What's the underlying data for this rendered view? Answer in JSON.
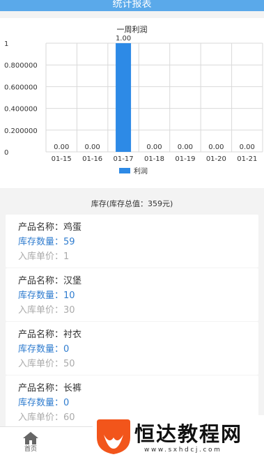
{
  "header": {
    "title": "统计报表"
  },
  "chart_data": {
    "type": "bar",
    "title": "一周利润",
    "categories": [
      "01-15",
      "01-16",
      "01-17",
      "01-18",
      "01-19",
      "01-20",
      "01-21"
    ],
    "series": [
      {
        "name": "利润",
        "values": [
          0,
          0,
          1,
          0,
          0,
          0,
          0
        ]
      }
    ],
    "data_labels": [
      "0.00",
      "0.00",
      "1.00",
      "0.00",
      "0.00",
      "0.00",
      "0.00"
    ],
    "y_ticks": [
      "0",
      "0.200000",
      "0.400000",
      "0.600000",
      "0.800000",
      "1"
    ],
    "ylim": [
      0,
      1
    ],
    "grid": true,
    "legend": "bottom-center",
    "bar_color": "#2d8ae6"
  },
  "inventory": {
    "title": "库存(库存总值：359元)",
    "items": [
      {
        "name": "产品名称：鸡蛋",
        "qty": "库存数量：59",
        "price": "入库单价：1"
      },
      {
        "name": "产品名称：汉堡",
        "qty": "库存数量：10",
        "price": "入库单价：30"
      },
      {
        "name": "产品名称：衬衣",
        "qty": "库存数量：0",
        "price": "入库单价：50"
      },
      {
        "name": "产品名称：长裤",
        "qty": "库存数量：0",
        "price": "入库单价：60"
      }
    ]
  },
  "tabbar": {
    "home_label": "首页"
  },
  "watermark": {
    "title": "恒达教程网",
    "url": "www.sxhdcj.com"
  },
  "colors": {
    "header_bg": "#5aa9ea",
    "accent_blue": "#2f7ccf",
    "logo_orange": "#f2551b"
  },
  "icons": {
    "home": "home-icon",
    "logo": "watermark-logo-icon"
  }
}
